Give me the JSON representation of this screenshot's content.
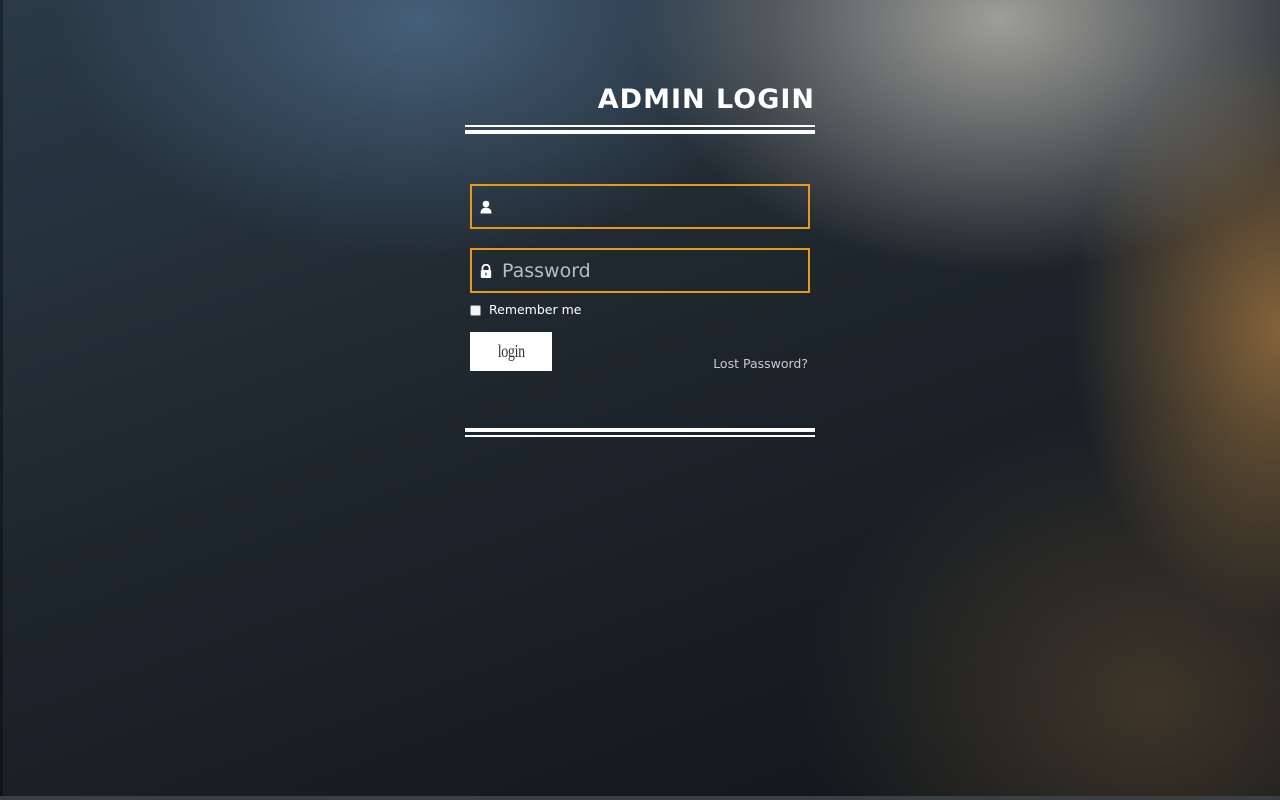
{
  "login": {
    "title": "ADMIN LOGIN",
    "username": {
      "value": "",
      "placeholder": "",
      "icon": "user-icon"
    },
    "password": {
      "value": "",
      "placeholder": "Password",
      "icon": "lock-icon"
    },
    "remember_label": "Remember me",
    "remember_checked": false,
    "login_label": "login",
    "lost_password_label": "Lost Password?"
  },
  "colors": {
    "field_border": "#e8981a",
    "text": "#ffffff",
    "link": "#c8cbce"
  }
}
